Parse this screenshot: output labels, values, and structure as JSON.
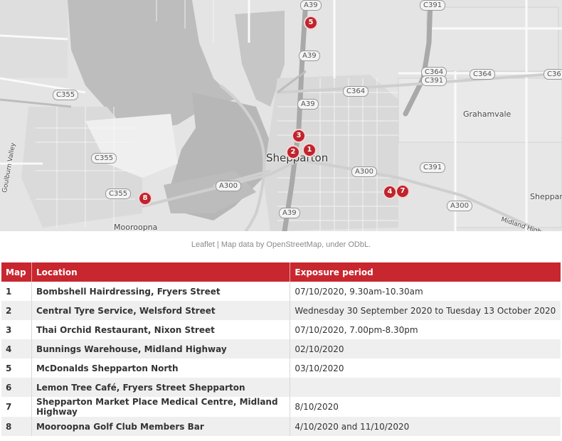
{
  "map": {
    "place_labels": {
      "shepparton": "Shepparton",
      "mooroopna": "Mooroopna",
      "grahamvale": "Grahamvale",
      "shepparton_east": "Sheppart",
      "goulburn_valley": "Goulburn Valley",
      "midland_highway": "Midland Highway"
    },
    "road_labels": {
      "a39_top": "A39",
      "a39_mid": "A39",
      "a39_center": "A39",
      "a39_bottom": "A39",
      "c391_top": "C391",
      "c355_left": "C355",
      "c355_mid": "C355",
      "c355_bottom": "C355",
      "c364_a": "C364",
      "c364_b": "C364",
      "c364_c": "C36",
      "c364_c391": "C364",
      "c391_stack": "C391",
      "c391_right": "C391",
      "a300_center": "A300",
      "a300_left": "A300",
      "a300_right": "A300"
    },
    "markers": [
      "1",
      "2",
      "3",
      "4",
      "5",
      "7",
      "8"
    ],
    "colors": {
      "marker": "#c0242c",
      "header": "#c8272f"
    }
  },
  "attribution": "Leaflet | Map data by OpenStreetMap, under ODbL.",
  "table": {
    "headers": [
      "Map",
      "Location",
      "Exposure period"
    ],
    "rows": [
      {
        "map": "1",
        "location": "Bombshell Hairdressing, Fryers Street",
        "exposure": "07/10/2020, 9.30am-10.30am"
      },
      {
        "map": "2",
        "location": "Central Tyre Service, Welsford Street",
        "exposure": "Wednesday 30 September 2020 to Tuesday 13 October 2020"
      },
      {
        "map": "3",
        "location": "Thai Orchid Restaurant, Nixon Street",
        "exposure": "07/10/2020, 7.00pm-8.30pm"
      },
      {
        "map": "4",
        "location": "Bunnings Warehouse, Midland Highway",
        "exposure": "02/10/2020"
      },
      {
        "map": "5",
        "location": "McDonalds Shepparton North",
        "exposure": "03/10/2020"
      },
      {
        "map": "6",
        "location": "Lemon Tree Café, Fryers Street Shepparton",
        "exposure": ""
      },
      {
        "map": "7",
        "location": "Shepparton Market Place Medical Centre, Midland Highway",
        "exposure": "8/10/2020"
      },
      {
        "map": "8",
        "location": "Mooroopna Golf Club Members Bar",
        "exposure": "4/10/2020 and 11/10/2020"
      }
    ]
  }
}
